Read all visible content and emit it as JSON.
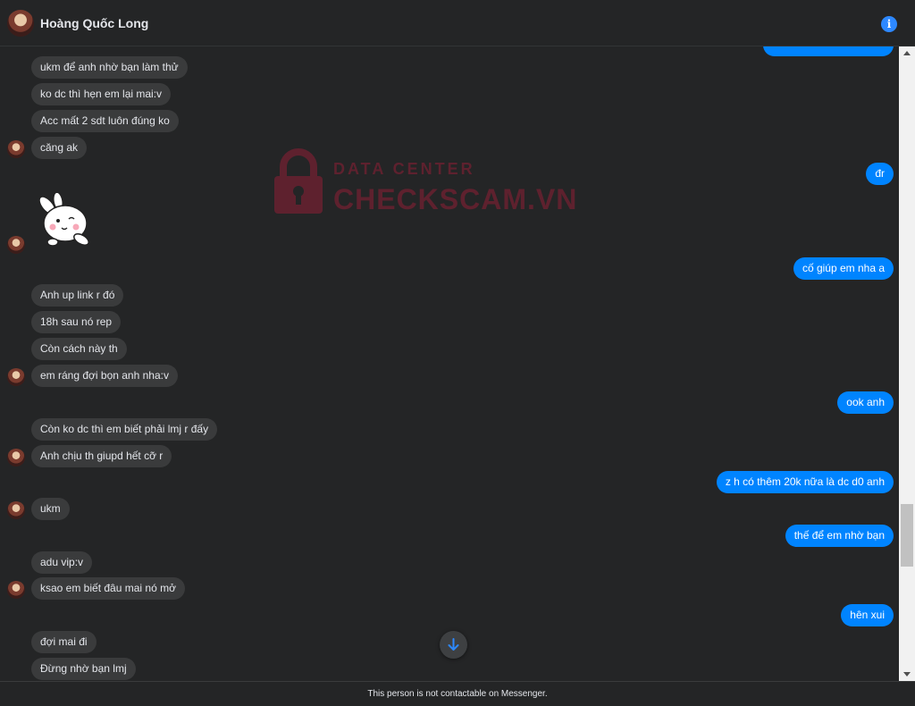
{
  "header": {
    "contact_name": "Hoàng Quốc Long",
    "info_icon": "info-icon"
  },
  "watermark": {
    "small_text": "DATA CENTER",
    "big_text": "CHECKSCAM.VN"
  },
  "messages_incoming": [
    "ukm để anh nhờ bạn làm thử",
    "ko dc thì hẹn em lại mai:v",
    "Acc mất 2 sdt luôn đúng ko",
    "căng ak",
    "Anh up link r đó",
    "18h sau nó rep",
    "Còn cách này th",
    "em ráng đợi bọn anh nha:v",
    "Còn ko dc thì em biết phải lmj r đấy",
    "Anh chịu th giupd hết cỡ r",
    "ukm",
    "adu vip:v",
    "ksao em biết đâu mai nó mở",
    "đợi mai đi",
    "Đừng nhờ bạn lmj"
  ],
  "messages_outgoing": [
    "đr",
    "cố giúp em nha a",
    "ook anh",
    "z h có thêm 20k nữa là dc d0 anh",
    "thế để em nhờ bạn",
    "hên xui"
  ],
  "footer": {
    "notice": "This person is not contactable on Messenger."
  },
  "colors": {
    "background": "#242526",
    "incoming_bubble": "#3a3b3c",
    "outgoing_bubble": "#0084ff",
    "accent": "#2d88ff"
  }
}
